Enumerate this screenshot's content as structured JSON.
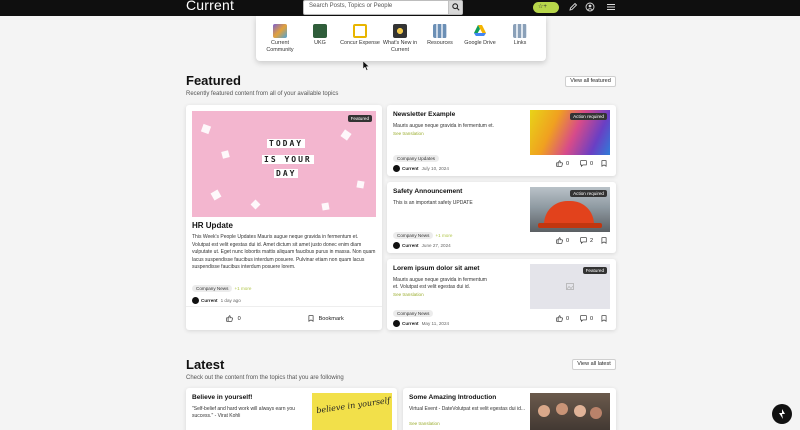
{
  "app_title": "Current",
  "search": {
    "placeholder": "Search Posts, Topics or People"
  },
  "header": {
    "badge_label": "☆+"
  },
  "apps": [
    {
      "label": "Current Community",
      "icon": "current-community-icon",
      "color": "#6a5acd"
    },
    {
      "label": "UKG",
      "icon": "ukg-icon",
      "color": "#2f5d3a"
    },
    {
      "label": "Concur Expense",
      "icon": "concur-icon",
      "color": "#e8b500"
    },
    {
      "label": "What's New in Current",
      "icon": "whats-new-icon",
      "color": "#444"
    },
    {
      "label": "Resources",
      "icon": "resources-icon",
      "color": "#6b8fb5"
    },
    {
      "label": "Google Drive",
      "icon": "google-drive-icon",
      "color": "#2ea44f"
    },
    {
      "label": "Links",
      "icon": "links-icon",
      "color": "#8aa0b8"
    }
  ],
  "featured": {
    "title": "Featured",
    "subtitle": "Recently featured content from all of your available topics",
    "view_all": "View all featured",
    "main": {
      "badge": "Featured",
      "image_text": [
        "TODAY",
        "IS YOUR",
        "DAY"
      ],
      "title": "HR Update",
      "body": "This Week's People Updates Mauris augue neque gravida in fermentum et. Volutpat est velit egestas dui id. Amet dictum sit amet justo donec enim diam vulputate ut. Eget nunc lobortis mattis aliquam faucibus purus in massa. Non quam lacus suspendisse faucibus interdum posuere. Pulvinar etiam non quam lacus suspendisse faucibus interdum posuere lorem.",
      "tag": "Company News",
      "more": "+1 more",
      "author": "Current",
      "date": "1 day ago",
      "likes": "0",
      "bookmark": "Bookmark"
    },
    "side": [
      {
        "title": "Newsletter Example",
        "body": "Mauris augue neque gravida in fermentum et.",
        "see": "See translation",
        "tag": "Company Updates",
        "more": "",
        "author": "Current",
        "date": "July 10, 2024",
        "badge": "Action required",
        "likes": "0",
        "comments": "0"
      },
      {
        "title": "Safety Announcement",
        "body": "This is an important safety UPDATE",
        "see": "",
        "tag": "Company News",
        "more": "+1 more",
        "author": "Current",
        "date": "June 27, 2024",
        "badge": "Action required",
        "likes": "0",
        "comments": "2"
      },
      {
        "title": "Lorem ipsum dolor sit amet",
        "body": "Mauris augue neque gravida in fermentum et. Volutpat est velit egestas dui id.",
        "see": "See translation",
        "tag": "Company News",
        "more": "",
        "author": "Current",
        "date": "May 11, 2024",
        "badge": "Featured",
        "likes": "0",
        "comments": "0"
      }
    ]
  },
  "latest": {
    "title": "Latest",
    "subtitle": "Check out the content from the topics that you are following",
    "view_all": "View all latest",
    "cards": [
      {
        "title": "Believe in yourself!",
        "body": "\"Self-belief and hard work will always earn you success.\" - Virat Kohli",
        "image_text": "believe in yourself"
      },
      {
        "title": "Some Amazing Introduction",
        "body": "Virtual Event - DateVolutpat est velit egestas dui id...",
        "see": "See translation"
      }
    ]
  }
}
